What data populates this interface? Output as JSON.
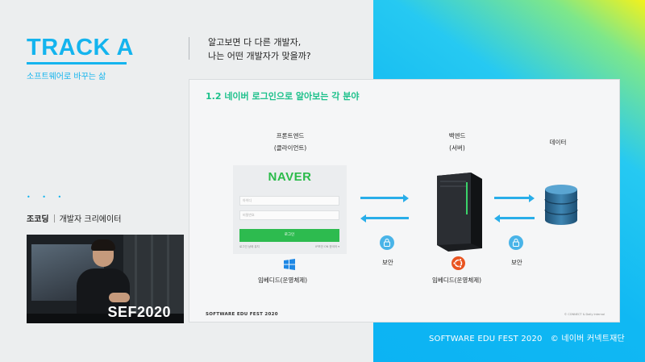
{
  "track": {
    "title": "TRACK A",
    "subtitle": "소프트웨어로 바꾸는 삶"
  },
  "question": {
    "line1": "알고보면 다 다른 개발자,",
    "line2": "나는 어떤 개발자가 맞을까?"
  },
  "decor": {
    "dots": "• • •"
  },
  "speaker": {
    "name": "조코딩",
    "role": "개발자 크리에이터"
  },
  "video": {
    "caption": "SEF2020"
  },
  "slide": {
    "title": "1.2 네이버 로그인으로 알아보는 각 분야",
    "frontend": {
      "label_line1": "프론트엔드",
      "label_line2": "(클라이언트)"
    },
    "backend": {
      "label_line1": "백엔드",
      "label_line2": "(서버)"
    },
    "database": {
      "label": "데이터"
    },
    "login": {
      "logo": "NAVER",
      "id_placeholder": "아이디",
      "pw_placeholder": "비밀번호",
      "button": "로그인",
      "keep_login": "로그인 상태 유지",
      "ip_security": "IP보안 ON",
      "lang": "한국어 ▾"
    },
    "security_label_left": "보안",
    "security_label_right": "보안",
    "embedded_left": "임베디드(운영체제)",
    "embedded_right": "임베디드(운영체제)",
    "footer_left": "SOFTWARE EDU FEST 2020",
    "footer_right": "© CONNECT & Daily Internal"
  },
  "footer": {
    "text": "SOFTWARE EDU FEST 2020   © 네이버 커넥트재단"
  },
  "colors": {
    "accent": "#14b4ee",
    "naver_green": "#2dbb4f",
    "slide_title": "#1bc08a",
    "arrow": "#29aee9"
  },
  "icons": [
    "windows-icon",
    "ubuntu-icon",
    "lock-icon",
    "server-icon",
    "database-icon"
  ]
}
